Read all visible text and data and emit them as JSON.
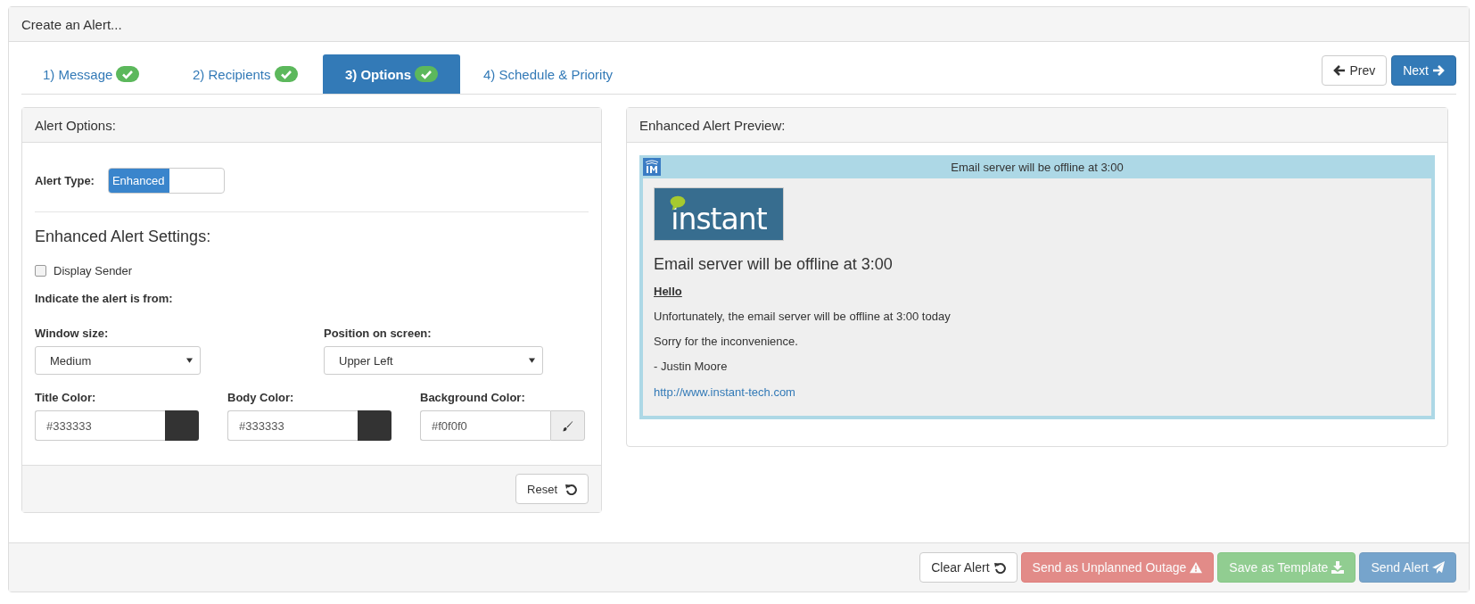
{
  "window": {
    "title": "Create an Alert..."
  },
  "tabs": [
    {
      "label": "1) Message",
      "selected": false,
      "completed": true
    },
    {
      "label": "2) Recipients",
      "selected": false,
      "completed": true
    },
    {
      "label": "3) Options",
      "selected": true,
      "completed": true
    },
    {
      "label": "4) Schedule & Priority",
      "selected": false,
      "completed": false
    }
  ],
  "nav_buttons": [
    {
      "label": "Prev",
      "kind": "prev"
    },
    {
      "label": "Next",
      "kind": "next"
    }
  ],
  "options_panel": {
    "title": "Alert Options:",
    "alert_type": {
      "label": "Alert Type:",
      "value": "Enhanced",
      "on": true
    },
    "settings_title": "Enhanced Alert Settings:",
    "display_sender": {
      "label": "Display Sender",
      "checked": false
    },
    "from_label": "Indicate the alert is from:",
    "selects": [
      {
        "label": "Window size:",
        "value": "Medium"
      },
      {
        "label": "Position on screen:",
        "value": "Upper Left"
      }
    ],
    "colors": [
      {
        "label": "Title Color:",
        "value": "#333333",
        "kind": "swatch",
        "color": "#333333"
      },
      {
        "label": "Body Color:",
        "value": "#333333",
        "kind": "swatch",
        "color": "#333333"
      },
      {
        "label": "Background Color:",
        "value": "#f0f0f0",
        "kind": "picker"
      }
    ],
    "reset_button": "Reset"
  },
  "preview_panel": {
    "title": "Enhanced Alert Preview:",
    "bar_title": "Email server will be offline at 3:00",
    "logo_text": "instant",
    "heading": "Email server will be offline at 3:00",
    "greeting": "Hello",
    "paragraphs": [
      "Unfortunately, the email server will be offline at 3:00 today",
      "Sorry for the inconvenience.",
      "- Justin Moore"
    ],
    "link": "http://www.instant-tech.com"
  },
  "footer_buttons": [
    {
      "label": "Clear Alert",
      "kind": "clear",
      "disabled": false
    },
    {
      "label": "Send as Unplanned Outage",
      "kind": "outage",
      "disabled": true
    },
    {
      "label": "Save as Template",
      "kind": "template",
      "disabled": true
    },
    {
      "label": "Send Alert",
      "kind": "send",
      "disabled": true
    }
  ]
}
